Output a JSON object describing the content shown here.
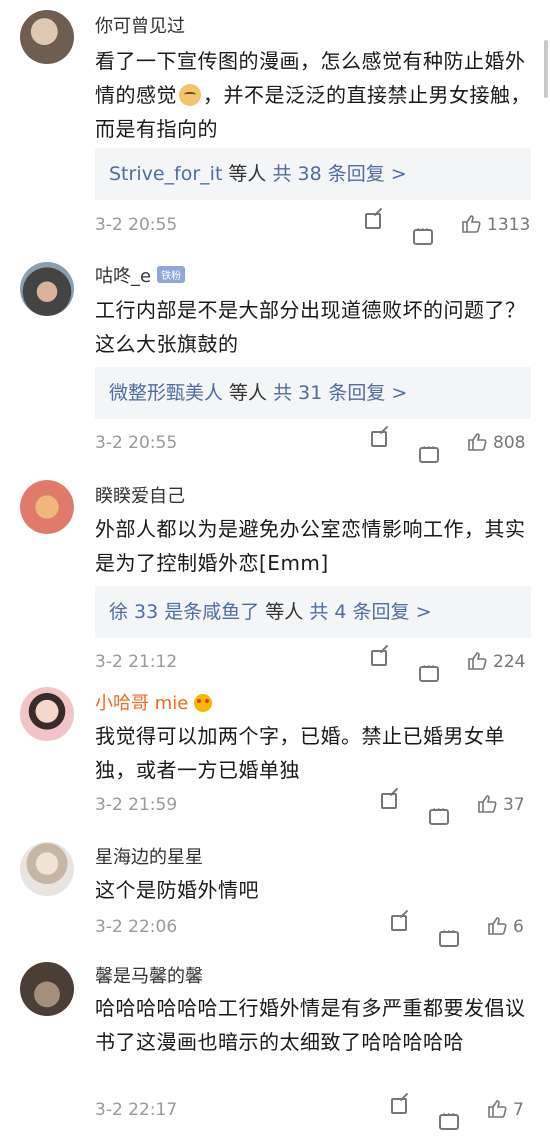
{
  "comments": [
    {
      "username": "你可曾见过",
      "text_parts": [
        "看了一下宣传图的漫画，怎么感觉有种防止婚外情的感觉",
        "，并不是泛泛的直接禁止男女接触，而是有指向的"
      ],
      "reply_who": "Strive_for_it",
      "reply_mid": " 等人 ",
      "reply_count": "共 38 条回复 >",
      "time": "3-2 20:55",
      "likes": "1313",
      "avatar_color": "#7a6a5c"
    },
    {
      "username": "咕咚_e",
      "badge": "铁粉",
      "text": "工行内部是不是大部分出现道德败坏的问题了？这么大张旗鼓的",
      "reply_who": "微整形甄美人",
      "reply_mid": " 等人 ",
      "reply_count": "共 31 条回复 >",
      "time": "3-2 20:55",
      "likes": "808",
      "avatar_color": "#3a3a3a"
    },
    {
      "username": "睽睽爱自己",
      "text": "外部人都以为是避免办公室恋情影响工作，其实是为了控制婚外恋[Emm]",
      "reply_who": "徐 33 是条咸鱼了",
      "reply_mid": " 等人 ",
      "reply_count": "共 4 条回复 >",
      "time": "3-2 21:12",
      "likes": "224",
      "avatar_color": "#e3936b"
    },
    {
      "username": "小哈哥 mie",
      "text": "我觉得可以加两个字，已婚。禁止已婚男女单独，或者一方已婚单独",
      "time": "3-2 21:59",
      "likes": "37",
      "avatar_color": "#e8b8bd"
    },
    {
      "username": "星海边的星星",
      "text": "这个是防婚外情吧",
      "time": "3-2 22:06",
      "likes": "6",
      "avatar_color": "#b9a896"
    },
    {
      "username": "馨是马馨的馨",
      "text": "哈哈哈哈哈哈工行婚外情是有多严重都要发倡议书了这漫画也暗示的太细致了哈哈哈哈哈",
      "time": "3-2 22:17",
      "likes": "7",
      "avatar_color": "#5b4c43"
    }
  ],
  "colors": {
    "link": "#4d6da0",
    "vip_name": "#f06a1e",
    "meta": "#999999",
    "reply_bg": "#f4f5f7"
  },
  "icons": [
    "share-icon",
    "comment-icon",
    "like-icon",
    "doge-emoji",
    "vip-emoji-badge"
  ]
}
